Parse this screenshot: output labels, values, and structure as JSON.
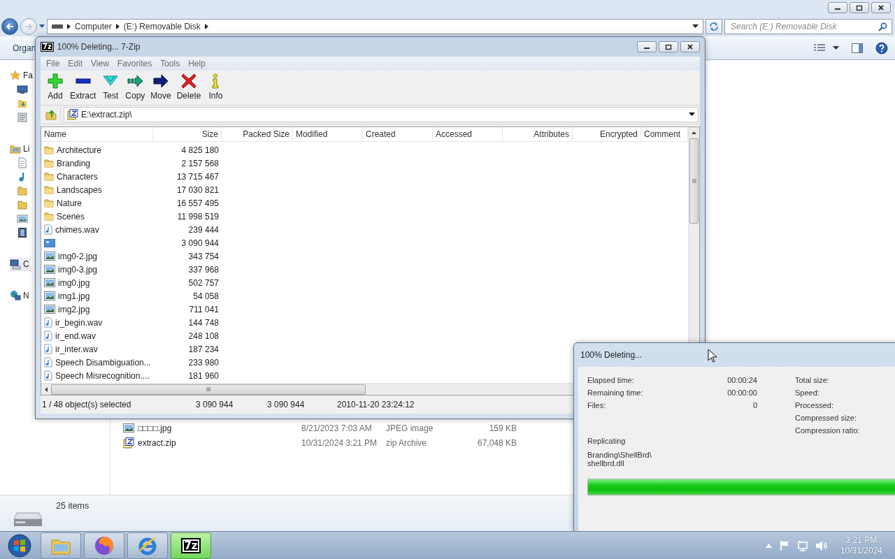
{
  "explorer": {
    "breadcrumb": [
      "Computer",
      "(E:) Removable Disk"
    ],
    "search": {
      "placeholder": "Search (E:) Removable Disk"
    },
    "command_bar": {
      "organize": "Organ"
    },
    "nav": [
      {
        "label": "Fa",
        "kind": "star",
        "selected": false
      },
      {
        "kind": "desktop",
        "selected": false
      },
      {
        "kind": "downloads",
        "selected": false
      },
      {
        "kind": "recent",
        "selected": false
      },
      {
        "label": "Li",
        "kind": "library",
        "selected": false
      },
      {
        "kind": "documents",
        "selected": false
      },
      {
        "kind": "music",
        "selected": false
      },
      {
        "kind": "folder",
        "selected": false
      },
      {
        "kind": "folder",
        "selected": false
      },
      {
        "kind": "pictures",
        "selected": false
      },
      {
        "kind": "videos",
        "selected": false
      },
      {
        "label": "C",
        "kind": "computer",
        "selected": true
      },
      {
        "label": "N",
        "kind": "network",
        "selected": false
      }
    ],
    "files": [
      {
        "name": "□□□□.jpg",
        "modified": "8/21/2023 7:03 AM",
        "type": "JPEG image",
        "size": "159 KB",
        "kind": "image"
      },
      {
        "name": "extract.zip",
        "modified": "10/31/2024 3:21 PM",
        "type": "zip Archive",
        "size": "67,048 KB",
        "kind": "zip"
      }
    ],
    "details": {
      "count": "25 items"
    }
  },
  "zip_window": {
    "logo": "7z",
    "title": "100% Deleting... 7-Zip",
    "menu": [
      "File",
      "Edit",
      "View",
      "Favorites",
      "Tools",
      "Help"
    ],
    "toolbar": [
      {
        "label": "Add",
        "kind": "add"
      },
      {
        "label": "Extract",
        "kind": "extract"
      },
      {
        "label": "Test",
        "kind": "test"
      },
      {
        "label": "Copy",
        "kind": "copy"
      },
      {
        "label": "Move",
        "kind": "move"
      },
      {
        "label": "Delete",
        "kind": "delete"
      },
      {
        "label": "Info",
        "kind": "info"
      }
    ],
    "path": "E:\\extract.zip\\",
    "columns": [
      "Name",
      "Size",
      "Packed Size",
      "Modified",
      "Created",
      "Accessed",
      "Attributes",
      "Encrypted",
      "Comment"
    ],
    "rows": [
      {
        "name": "Architecture",
        "size": "4 825 180",
        "kind": "folder"
      },
      {
        "name": "Branding",
        "size": "2 157 568",
        "kind": "folder"
      },
      {
        "name": "Characters",
        "size": "13 715 467",
        "kind": "folder"
      },
      {
        "name": "Landscapes",
        "size": "17 030 821",
        "kind": "folder"
      },
      {
        "name": "Nature",
        "size": "16 557 495",
        "kind": "folder"
      },
      {
        "name": "Scenes",
        "size": "11 998 519",
        "kind": "folder"
      },
      {
        "name": "chimes.wav",
        "size": "239 444",
        "kind": "audio"
      },
      {
        "size": "3 090 944",
        "kind": "blank"
      },
      {
        "name": "img0-2.jpg",
        "size": "343 754",
        "kind": "image"
      },
      {
        "name": "img0-3.jpg",
        "size": "337 968",
        "kind": "image"
      },
      {
        "name": "img0.jpg",
        "size": "502 757",
        "kind": "image"
      },
      {
        "name": "img1.jpg",
        "size": "54 058",
        "kind": "image"
      },
      {
        "name": "img2.jpg",
        "size": "711 041",
        "kind": "image"
      },
      {
        "name": "ir_begin.wav",
        "size": "144 748",
        "kind": "audio"
      },
      {
        "name": "ir_end.wav",
        "size": "248 108",
        "kind": "audio"
      },
      {
        "name": "ir_inter.wav",
        "size": "187 234",
        "kind": "audio"
      },
      {
        "name": "Speech Disambiguation...",
        "size": "233 980",
        "kind": "audio"
      },
      {
        "name": "Speech Misrecognition....",
        "size": "181 960",
        "kind": "audio"
      }
    ],
    "status": [
      "1 / 48 object(s) selected",
      "3 090 944",
      "3 090 944",
      "2010-11-20 23:24:12"
    ]
  },
  "progress_dialog": {
    "title": "100% Deleting...",
    "stats": [
      {
        "label": "Elapsed time:",
        "value": "00:00:24"
      },
      {
        "label": "Remaining time:",
        "value": "00:00:00"
      },
      {
        "label": "Files:",
        "value": "0"
      }
    ],
    "right_labels": [
      "Total size:",
      "Speed:",
      "Processed:",
      "Compressed size:",
      "Compression ratio:"
    ],
    "operation": "Replicating",
    "current_file": [
      "Branding\\ShellBrd\\",
      "shellbrd.dll"
    ],
    "progress": {
      "level": 1.0
    }
  },
  "taskbar": {
    "apps": [
      {
        "kind": "explorer",
        "selected": false
      },
      {
        "kind": "firefox",
        "selected": false
      },
      {
        "kind": "ie",
        "selected": false
      },
      {
        "kind": "sevenzip",
        "label": "7z",
        "selected": true
      }
    ],
    "time": "3:21 PM",
    "date": "10/31/2024"
  }
}
